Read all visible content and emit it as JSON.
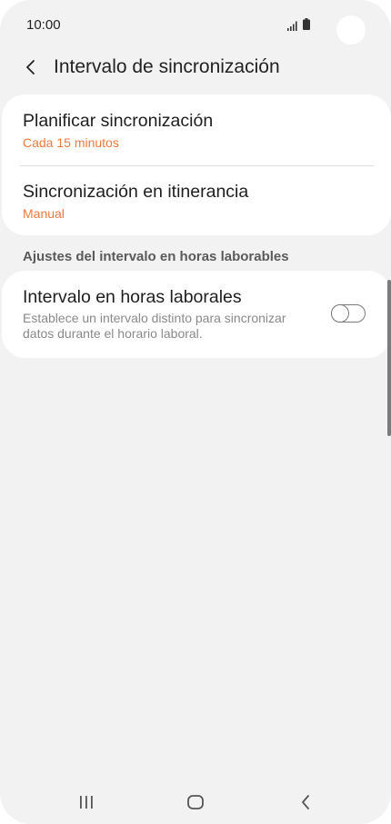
{
  "status_bar": {
    "time": "10:00"
  },
  "header": {
    "title": "Intervalo de sincronización",
    "back_icon": "chevron-left-icon"
  },
  "sync_settings": {
    "schedule": {
      "title": "Planificar sincronización",
      "value": "Cada 15 minutos"
    },
    "roaming": {
      "title": "Sincronización en itinerancia",
      "value": "Manual"
    }
  },
  "work_hours_section": {
    "header": "Ajustes del intervalo en horas laborables",
    "item": {
      "title": "Intervalo en horas laborales",
      "description": "Establece un intervalo distinto para sincronizar datos durante el horario laboral.",
      "enabled": false
    }
  },
  "nav_bar": {
    "recents_icon": "recents-icon",
    "home_icon": "home-icon",
    "back_icon": "back-icon"
  },
  "colors": {
    "accent": "#ee7a3c",
    "background": "#f2f2f2",
    "card": "#ffffff"
  }
}
